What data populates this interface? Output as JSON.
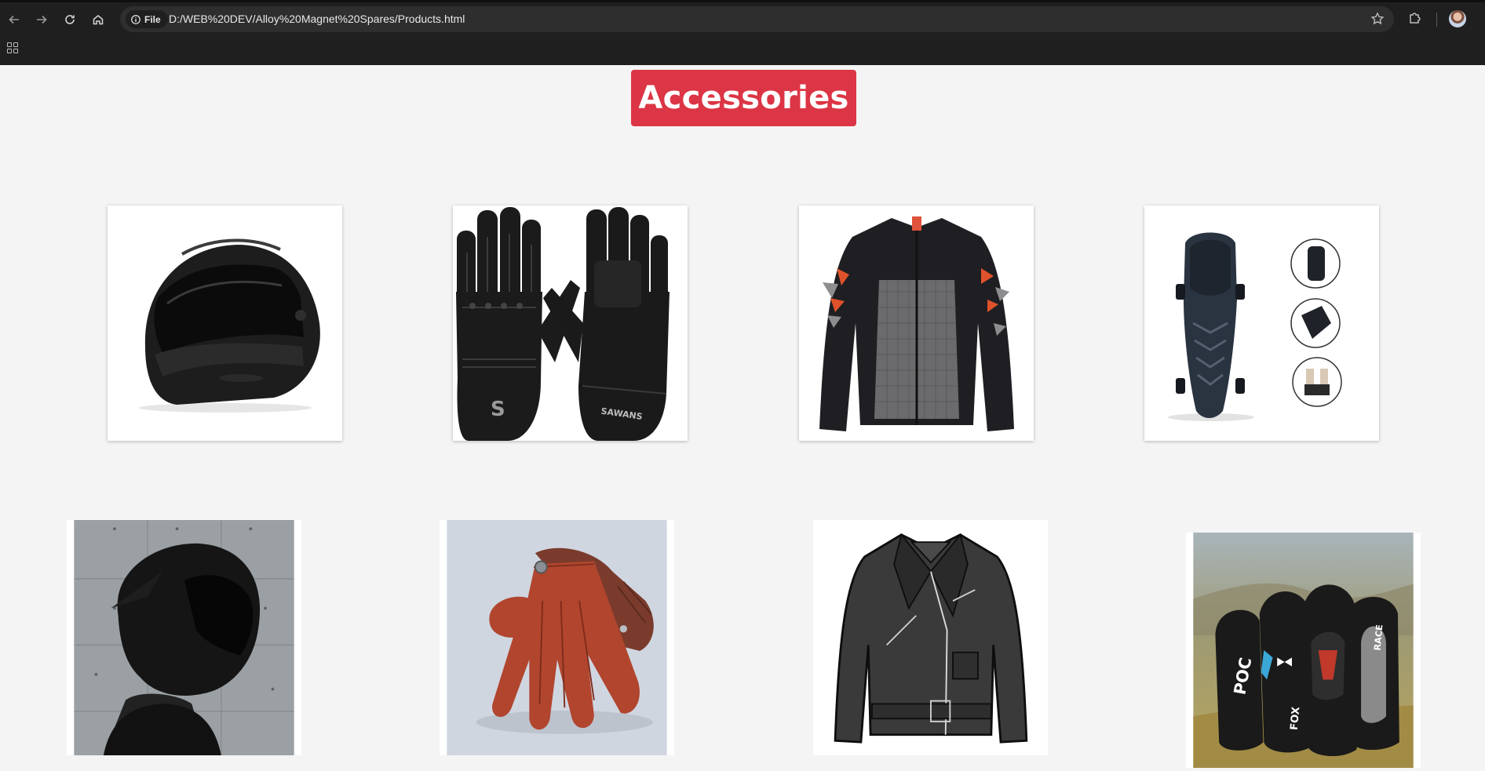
{
  "browser": {
    "chip_label": "File",
    "url": "D:/WEB%20DEV/Alloy%20Magnet%20Spares/Products.html"
  },
  "page": {
    "heading": "Accessories",
    "accent_color": "#dc3545"
  },
  "products": [
    {
      "icon": "helmet-image"
    },
    {
      "icon": "gloves-image",
      "brand_text": "SAWANS"
    },
    {
      "icon": "jacket-image"
    },
    {
      "icon": "knee-guard-image"
    },
    {
      "icon": "helmet-rider-image"
    },
    {
      "icon": "leather-gloves-image"
    },
    {
      "icon": "leather-jacket-image"
    },
    {
      "icon": "knee-pads-image",
      "brand_text": "POC"
    }
  ]
}
